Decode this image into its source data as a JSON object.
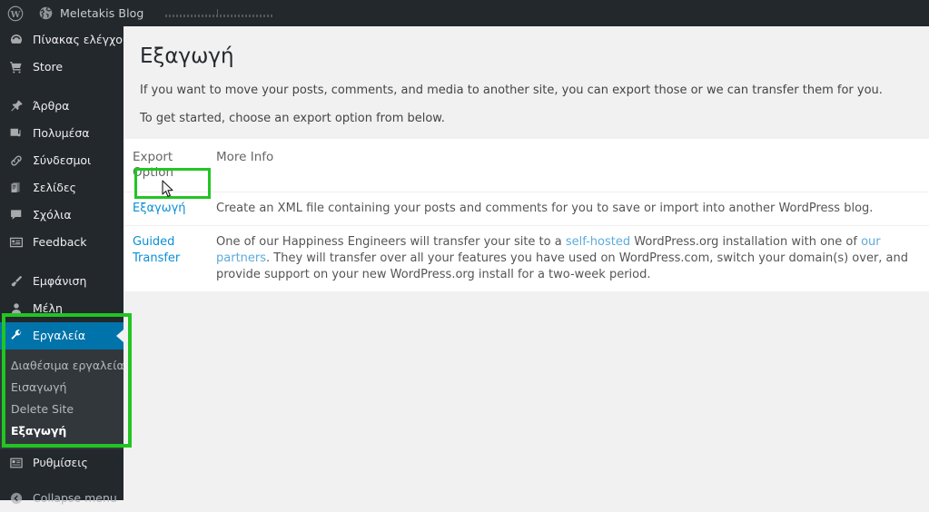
{
  "adminbar": {
    "wp_logo_icon": "wordpress-logo-icon",
    "site_icon": "globe-icon",
    "site_name": "Meletakis Blog"
  },
  "sidebar": {
    "items": [
      {
        "label": "Πίνακας ελέγχου",
        "icon": "dashboard-gauge-icon",
        "name": "dashboard",
        "active": false,
        "gap": false
      },
      {
        "label": "Store",
        "icon": "cart-icon",
        "name": "store",
        "active": false,
        "gap": false
      },
      {
        "label": "Άρθρα",
        "icon": "pin-icon",
        "name": "posts",
        "active": false,
        "gap": true
      },
      {
        "label": "Πολυμέσα",
        "icon": "media-icon",
        "name": "media",
        "active": false,
        "gap": false
      },
      {
        "label": "Σύνδεσμοι",
        "icon": "link-icon",
        "name": "links",
        "active": false,
        "gap": false
      },
      {
        "label": "Σελίδες",
        "icon": "pages-icon",
        "name": "pages",
        "active": false,
        "gap": false
      },
      {
        "label": "Σχόλια",
        "icon": "comment-icon",
        "name": "comments",
        "active": false,
        "gap": false
      },
      {
        "label": "Feedback",
        "icon": "feedback-icon",
        "name": "feedback",
        "active": false,
        "gap": false
      },
      {
        "label": "Εμφάνιση",
        "icon": "paintbrush-icon",
        "name": "appearance",
        "active": false,
        "gap": true
      },
      {
        "label": "Μέλη",
        "icon": "user-icon",
        "name": "users",
        "active": false,
        "gap": false
      },
      {
        "label": "Εργαλεία",
        "icon": "wrench-icon",
        "name": "tools",
        "active": true,
        "gap": false
      }
    ],
    "submenu": [
      {
        "label": "Διαθέσιμα εργαλεία",
        "current": false
      },
      {
        "label": "Εισαγωγή",
        "current": false
      },
      {
        "label": "Delete Site",
        "current": false
      },
      {
        "label": "Εξαγωγή",
        "current": true
      }
    ],
    "items_after": [
      {
        "label": "Ρυθμίσεις",
        "icon": "settings-icon",
        "name": "settings",
        "active": false,
        "gap": false
      }
    ],
    "collapse": {
      "label": "Collapse menu",
      "icon": "collapse-arrow-icon"
    }
  },
  "main": {
    "title": "Εξαγωγή",
    "intro_1": "If you want to move your posts, comments, and media to another site, you can export those or we can transfer them for you.",
    "intro_2": "To get started, choose an export option from below.",
    "table": {
      "headers": [
        "Export Option",
        "More Info"
      ],
      "rows": [
        {
          "option": "Εξαγωγή",
          "info_parts": [
            {
              "text": "Create an XML file containing your posts and comments for you to save or import into another WordPress blog.",
              "link": false
            }
          ]
        },
        {
          "option": "Guided Transfer",
          "info_parts": [
            {
              "text": "One of our Happiness Engineers will transfer your site to a ",
              "link": false
            },
            {
              "text": "self-hosted",
              "link": true
            },
            {
              "text": " WordPress.org installation with one of ",
              "link": false
            },
            {
              "text": "our partners",
              "link": true
            },
            {
              "text": ". They will transfer over all your features you have used on WordPress.com, switch your domain(s) over, and provide support on your new WordPress.org install for a two-week period.",
              "link": false
            }
          ]
        }
      ]
    }
  },
  "annotations": {
    "highlight_color": "#22c522",
    "sidebar_box": "tools-submenu-highlight",
    "export_link_box": "export-link-highlight"
  },
  "colors": {
    "adminbar_bg": "#23282d",
    "sidebar_bg": "#23282d",
    "submenu_bg": "#32373c",
    "active_item_bg": "#0073aa",
    "link_blue": "#0a8fd6",
    "content_bg": "#f1f1f1"
  }
}
